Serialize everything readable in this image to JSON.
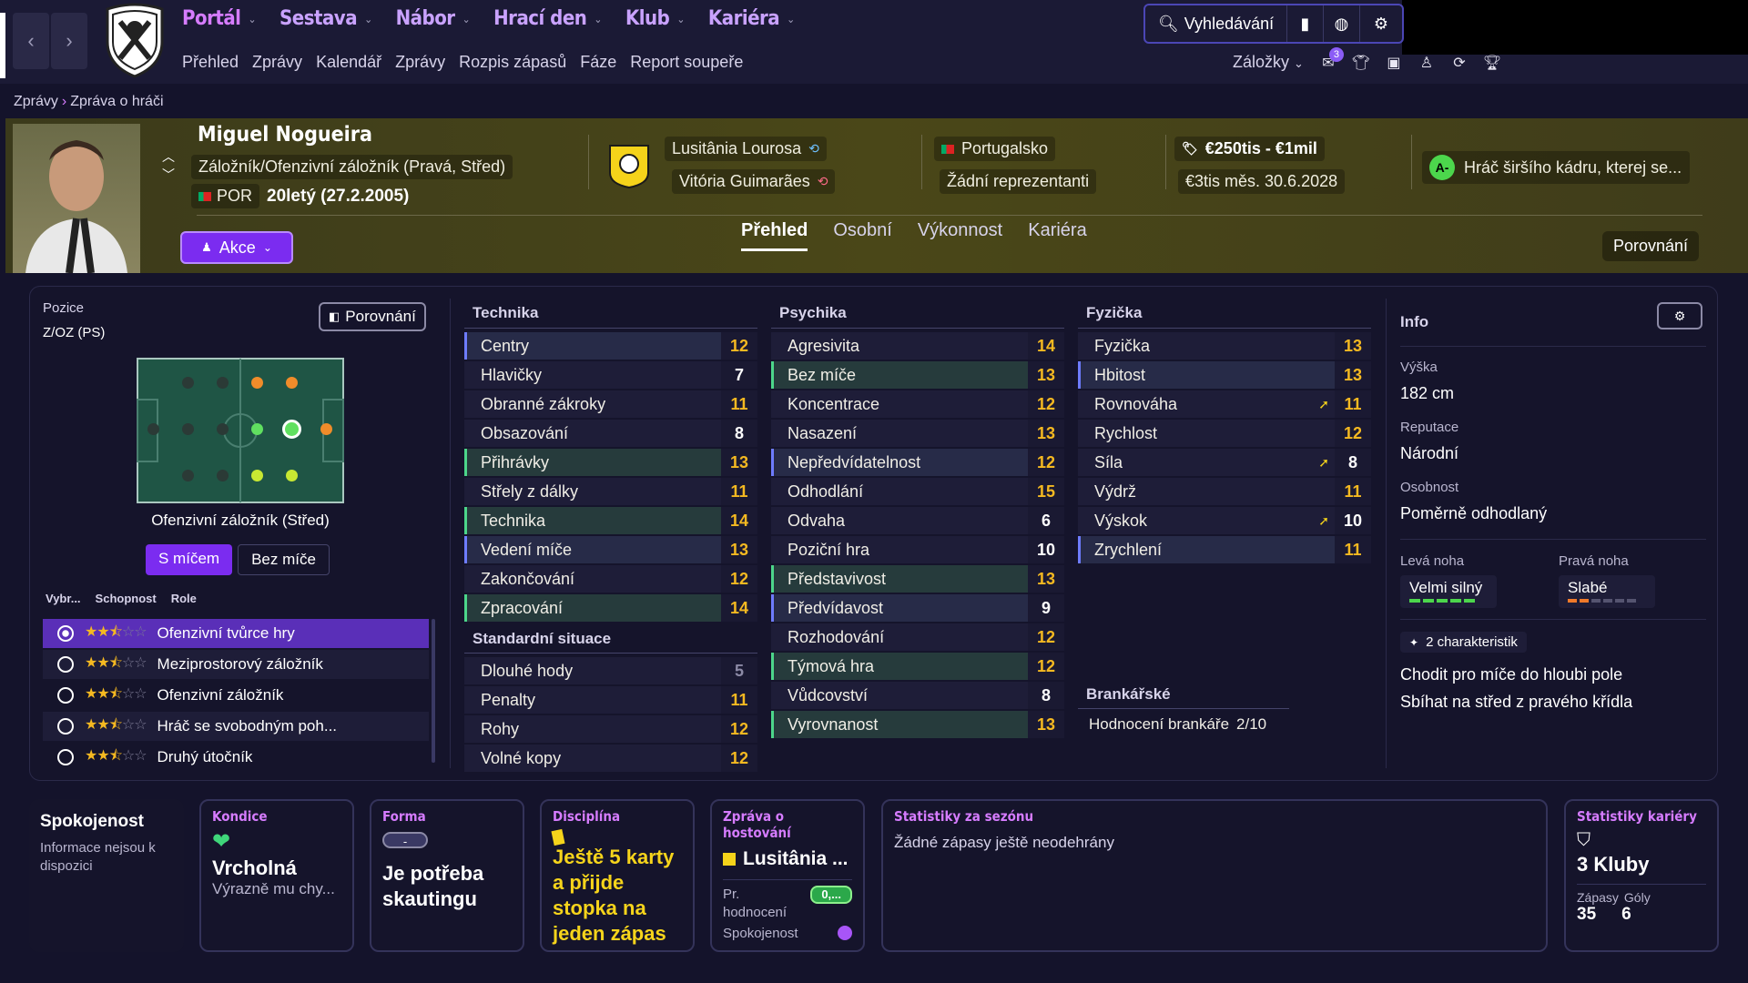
{
  "nav": {
    "main": [
      "Portál",
      "Sestava",
      "Nábor",
      "Hrací den",
      "Klub",
      "Kariéra"
    ],
    "sub": [
      "Přehled",
      "Zprávy",
      "Kalendář",
      "Zprávy",
      "Rozpis zápasů",
      "Fáze",
      "Report soupeře"
    ],
    "search_label": "Vyhledávání",
    "bookmarks_label": "Záložky",
    "notif_count": "3"
  },
  "breadcrumb": [
    "Zprávy",
    "Zpráva o hráči"
  ],
  "player": {
    "name": "Miguel Nogueira",
    "position": "Záložník/Ofenzivní záložník (Pravá, Střed)",
    "nationality_code": "POR",
    "age": "20letý (27.2.2005)",
    "action_label": "Akce",
    "club": "Lusitânia Lourosa",
    "parent_club": "Vitória Guimarães",
    "country": "Portugalsko",
    "intl": "Žádní reprezentanti",
    "value": "€250tis - €1mil",
    "contract": "€3tis měs. 30.6.2028",
    "role_grade": "A-",
    "role_status": "Hráč širšího kádru, kterej se..."
  },
  "tabs": [
    "Přehled",
    "Osobní",
    "Výkonnost",
    "Kariéra"
  ],
  "compare_label": "Porovnání",
  "position_panel": {
    "label": "Pozice",
    "value": "Z/OZ (PS)",
    "compare_label": "Porovnání",
    "selected_position": "Ofenzivní záložník (Střed)",
    "toggle": [
      "S míčem",
      "Bez míče"
    ],
    "headers": [
      "Vybr...",
      "Schopnost",
      "Role"
    ],
    "roles": [
      {
        "name": "Ofenzivní tvůrce hry",
        "stars": 2.5,
        "selected": true
      },
      {
        "name": "Meziprostorový záložník",
        "stars": 2.5,
        "selected": false
      },
      {
        "name": "Ofenzivní záložník",
        "stars": 2.5,
        "selected": false
      },
      {
        "name": "Hráč se svobodným poh...",
        "stars": 2.5,
        "selected": false
      },
      {
        "name": "Druhý útočník",
        "stars": 2.5,
        "selected": false
      }
    ]
  },
  "technika": {
    "title": "Technika",
    "items": [
      {
        "n": "Centry",
        "v": "12"
      },
      {
        "n": "Hlavičky",
        "v": "7"
      },
      {
        "n": "Obranné zákroky",
        "v": "11"
      },
      {
        "n": "Obsazování",
        "v": "8"
      },
      {
        "n": "Přihrávky",
        "v": "13"
      },
      {
        "n": "Střely z dálky",
        "v": "11"
      },
      {
        "n": "Technika",
        "v": "14"
      },
      {
        "n": "Vedení míče",
        "v": "13"
      },
      {
        "n": "Zakončování",
        "v": "12"
      },
      {
        "n": "Zpracování",
        "v": "14"
      }
    ]
  },
  "standard": {
    "title": "Standardní situace",
    "items": [
      {
        "n": "Dlouhé hody",
        "v": "5"
      },
      {
        "n": "Penalty",
        "v": "11"
      },
      {
        "n": "Rohy",
        "v": "12"
      },
      {
        "n": "Volné kopy",
        "v": "12"
      }
    ]
  },
  "psychika": {
    "title": "Psychika",
    "items": [
      {
        "n": "Agresivita",
        "v": "14"
      },
      {
        "n": "Bez míče",
        "v": "13"
      },
      {
        "n": "Koncentrace",
        "v": "12"
      },
      {
        "n": "Nasazení",
        "v": "13"
      },
      {
        "n": "Nepředvídatelnost",
        "v": "12"
      },
      {
        "n": "Odhodlání",
        "v": "15"
      },
      {
        "n": "Odvaha",
        "v": "6"
      },
      {
        "n": "Poziční hra",
        "v": "10"
      },
      {
        "n": "Představivost",
        "v": "13"
      },
      {
        "n": "Předvídavost",
        "v": "9"
      },
      {
        "n": "Rozhodování",
        "v": "12"
      },
      {
        "n": "Týmová hra",
        "v": "12"
      },
      {
        "n": "Vůdcovství",
        "v": "8"
      },
      {
        "n": "Vyrovnanost",
        "v": "13"
      }
    ]
  },
  "fyzicka": {
    "title": "Fyzička",
    "items": [
      {
        "n": "Fyzička",
        "v": "13"
      },
      {
        "n": "Hbitost",
        "v": "13"
      },
      {
        "n": "Rovnováha",
        "v": "11"
      },
      {
        "n": "Rychlost",
        "v": "12"
      },
      {
        "n": "Síla",
        "v": "8"
      },
      {
        "n": "Výdrž",
        "v": "11"
      },
      {
        "n": "Výskok",
        "v": "10"
      },
      {
        "n": "Zrychlení",
        "v": "11"
      }
    ]
  },
  "brankar": {
    "title": "Brankářské",
    "label": "Hodnocení brankáře",
    "value": "2/10"
  },
  "info": {
    "title": "Info",
    "height_label": "Výška",
    "height": "182 cm",
    "rep_label": "Reputace",
    "rep": "Národní",
    "pers_label": "Osobnost",
    "pers": "Poměrně odhodlaný",
    "left_foot_label": "Levá noha",
    "left_foot": "Velmi silný",
    "right_foot_label": "Pravá noha",
    "right_foot": "Slabé",
    "traits_label": "2 charakteristik",
    "traits": [
      "Chodit pro míče do hloubi pole",
      "Sbíhat na střed z pravého křídla"
    ]
  },
  "cards": {
    "spok": {
      "title": "Spokojenost",
      "text": "Informace nejsou k dispozici"
    },
    "kondice": {
      "title": "Kondice",
      "big": "Vrcholná",
      "sub": "Výrazně mu chy..."
    },
    "forma": {
      "title": "Forma",
      "pill": "-",
      "big": "Je potřeba skautingu"
    },
    "disc": {
      "title": "Disciplína",
      "text": "Ještě 5 karty a přijde stopka na jeden zápas"
    },
    "loan": {
      "title": "Zpráva o hostování",
      "club": "Lusitânia ...",
      "avg_label": "Pr. hodnocení",
      "avg": "0,...",
      "sat_label": "Spokojenost"
    },
    "season": {
      "title": "Statistiky za sezónu",
      "text": "Žádné zápasy ještě neodehrány"
    },
    "career": {
      "title": "Statistiky kariéry",
      "big": "3 Kluby",
      "apps_label": "Zápasy",
      "goals_label": "Góly",
      "apps": "35",
      "goals": "6"
    }
  }
}
